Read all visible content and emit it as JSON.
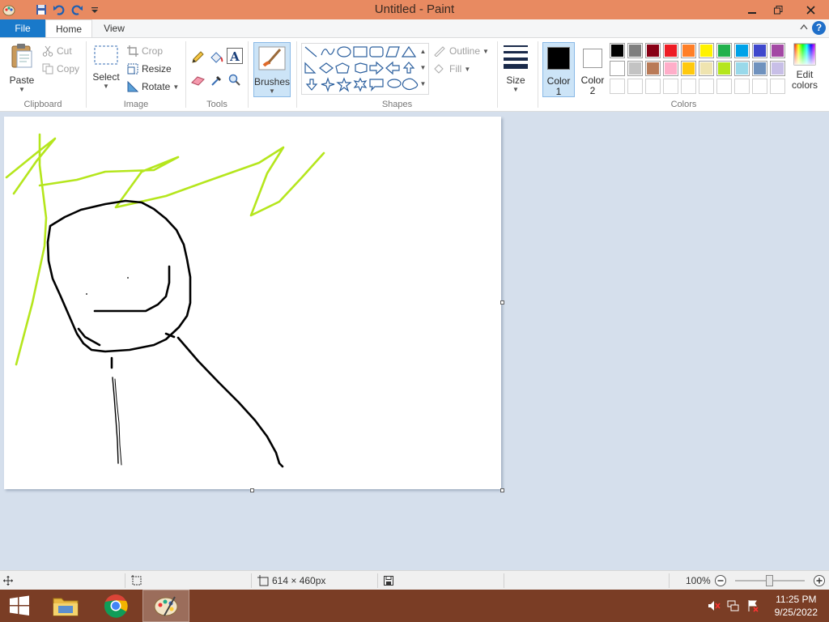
{
  "window": {
    "title": "Untitled - Paint"
  },
  "tabs": {
    "file": "File",
    "home": "Home",
    "view": "View"
  },
  "clipboard": {
    "paste": "Paste",
    "cut": "Cut",
    "copy": "Copy",
    "label": "Clipboard"
  },
  "image": {
    "select": "Select",
    "crop": "Crop",
    "resize": "Resize",
    "rotate": "Rotate",
    "label": "Image"
  },
  "tools": {
    "label": "Tools"
  },
  "brushes": {
    "label": "Brushes"
  },
  "shapes": {
    "outline": "Outline",
    "fill": "Fill",
    "label": "Shapes"
  },
  "size": {
    "label": "Size"
  },
  "colors": {
    "color1_a": "Color",
    "color1_b": "1",
    "color2_a": "Color",
    "color2_b": "2",
    "edit_a": "Edit",
    "edit_b": "colors",
    "label": "Colors",
    "color1": "#000000",
    "color2": "#ffffff",
    "palette_row1": [
      "#000000",
      "#7f7f7f",
      "#880015",
      "#ed1c24",
      "#ff7f27",
      "#fff200",
      "#22b14c",
      "#00a2e8",
      "#3f48cc",
      "#a349a4"
    ],
    "palette_row2": [
      "#ffffff",
      "#c3c3c3",
      "#b97a57",
      "#ffaec9",
      "#ffc90e",
      "#efe4b0",
      "#b5e61d",
      "#99d9ea",
      "#7092be",
      "#c8bfe7"
    ],
    "palette_row3": [
      "#ffffff",
      "#ffffff",
      "#ffffff",
      "#ffffff",
      "#ffffff",
      "#ffffff",
      "#ffffff",
      "#ffffff",
      "#ffffff",
      "#ffffff"
    ]
  },
  "drawing": {
    "stroke_black": "#000000",
    "stroke_green": "#b5e61d"
  },
  "status": {
    "canvas_size": "614 × 460px",
    "zoom": "100%",
    "zoom_fraction": 0.5
  },
  "taskbar": {
    "time": "11:25 PM",
    "date": "9/25/2022"
  }
}
